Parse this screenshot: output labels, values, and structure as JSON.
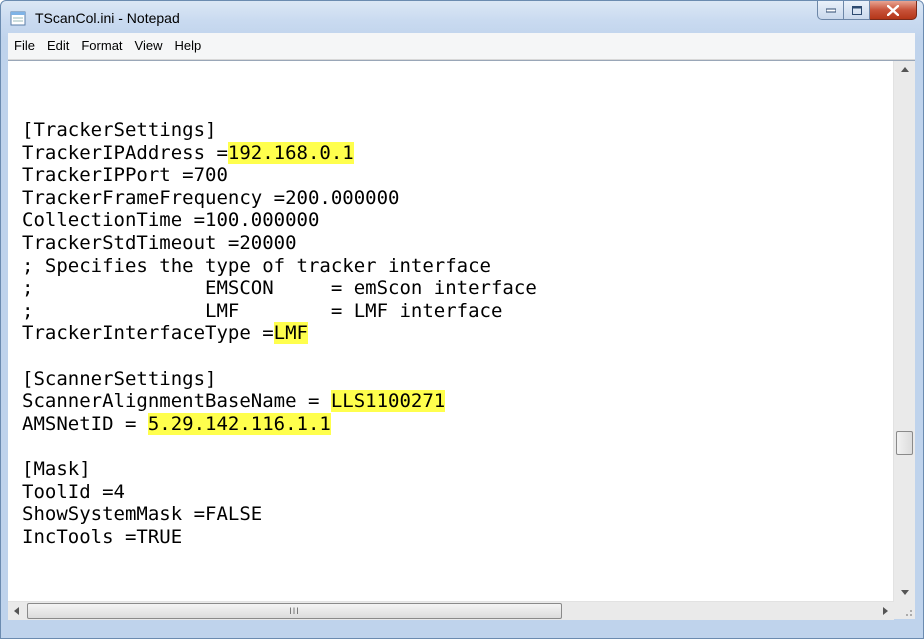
{
  "window": {
    "title": "TScanCol.ini - Notepad"
  },
  "menu": {
    "items": [
      "File",
      "Edit",
      "Format",
      "View",
      "Help"
    ]
  },
  "content": {
    "lines": [
      [
        {
          "t": "[TrackerSettings]"
        }
      ],
      [
        {
          "t": "TrackerIPAddress ="
        },
        {
          "t": "192.168.0.1",
          "h": true
        }
      ],
      [
        {
          "t": "TrackerIPPort =700"
        }
      ],
      [
        {
          "t": "TrackerFrameFrequency =200.000000"
        }
      ],
      [
        {
          "t": "CollectionTime =100.000000"
        }
      ],
      [
        {
          "t": "TrackerStdTimeout =20000"
        }
      ],
      [
        {
          "t": "; Specifies the type of tracker interface"
        }
      ],
      [
        {
          "t": ";               EMSCON     = emScon interface"
        }
      ],
      [
        {
          "t": ";               LMF        = LMF interface"
        }
      ],
      [
        {
          "t": "TrackerInterfaceType ="
        },
        {
          "t": "LMF",
          "h": true
        }
      ],
      [
        {
          "t": ""
        }
      ],
      [
        {
          "t": "[ScannerSettings]"
        }
      ],
      [
        {
          "t": "ScannerAlignmentBaseName = "
        },
        {
          "t": "LLS1100271",
          "h": true
        }
      ],
      [
        {
          "t": "AMSNetID = "
        },
        {
          "t": "5.29.142.116.1.1",
          "h": true
        }
      ],
      [
        {
          "t": ""
        }
      ],
      [
        {
          "t": "[Mask]"
        }
      ],
      [
        {
          "t": "ToolId =4"
        }
      ],
      [
        {
          "t": "ShowSystemMask =FALSE"
        }
      ],
      [
        {
          "t": "IncTools =TRUE"
        }
      ]
    ]
  },
  "scrollbars": {
    "horizontal_grip": "III"
  },
  "colors": {
    "highlight": "#ffff4d",
    "close_button": "#c8533a"
  }
}
